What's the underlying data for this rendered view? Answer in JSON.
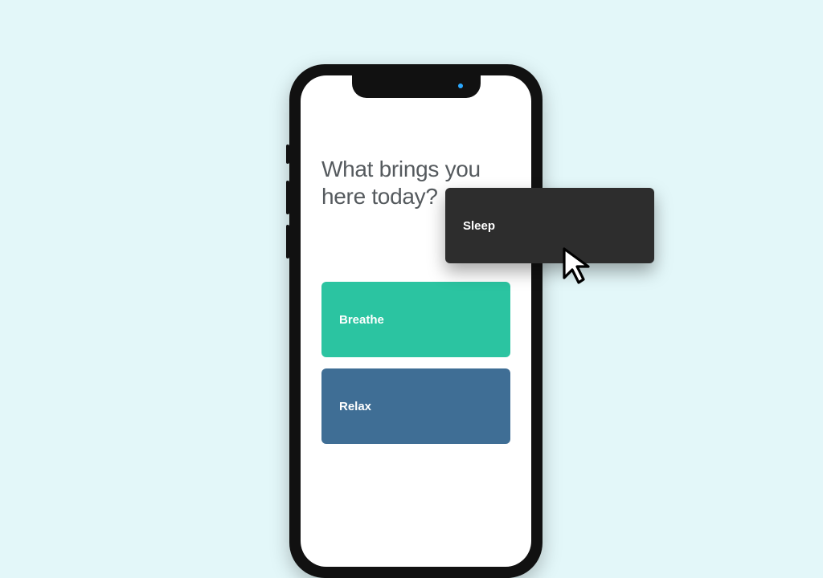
{
  "prompt": "What brings you here today?",
  "cards": {
    "sleep": {
      "label": "Sleep",
      "color": "#2d2d2d"
    },
    "breathe": {
      "label": "Breathe",
      "color": "#2bc4a1"
    },
    "relax": {
      "label": "Relax",
      "color": "#3f6e95"
    }
  },
  "background_color": "#e3f7f9"
}
